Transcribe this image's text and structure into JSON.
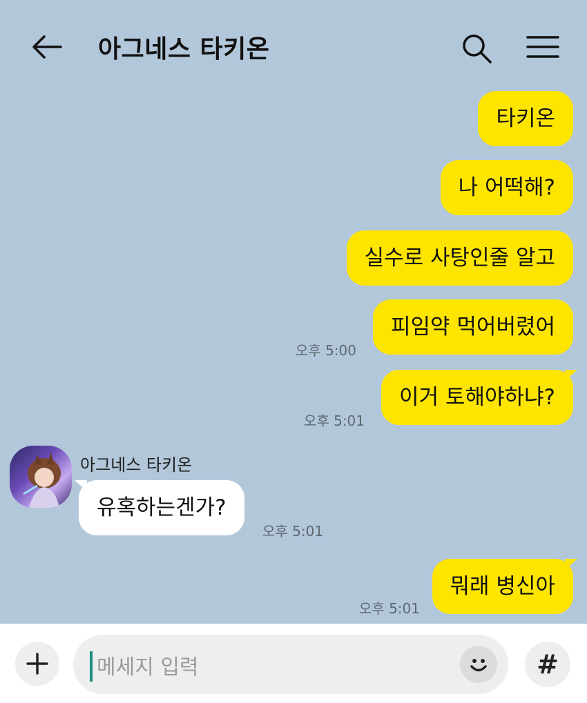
{
  "header": {
    "title": "아그네스 타키온",
    "back_icon": "arrow-left-icon",
    "search_icon": "search-icon",
    "menu_icon": "hamburger-menu-icon"
  },
  "messages": [
    {
      "from": "me",
      "text": "타키온"
    },
    {
      "from": "me",
      "text": "나 어떡해?"
    },
    {
      "from": "me",
      "text": "실수로 사탕인줄 알고"
    },
    {
      "from": "me",
      "text": "피임약 먹어버렸어",
      "time": "오후 5:00"
    },
    {
      "from": "me",
      "text": "이거 토해야하냐?",
      "time": "오후 5:01"
    },
    {
      "from": "them",
      "sender": "아그네스 타키온",
      "text": "유혹하는겐가?",
      "time": "오후 5:01"
    },
    {
      "from": "me",
      "text": "뭐래 병신아",
      "time": "오후 5:01"
    }
  ],
  "composer": {
    "placeholder": "메세지 입력",
    "plus_icon": "plus-icon",
    "emoji_icon": "emoji-icon",
    "hash_label": "#"
  },
  "colors": {
    "background": "#b2c7da",
    "my_bubble": "#fee500",
    "their_bubble": "#ffffff",
    "caret": "#1b8f7d"
  }
}
